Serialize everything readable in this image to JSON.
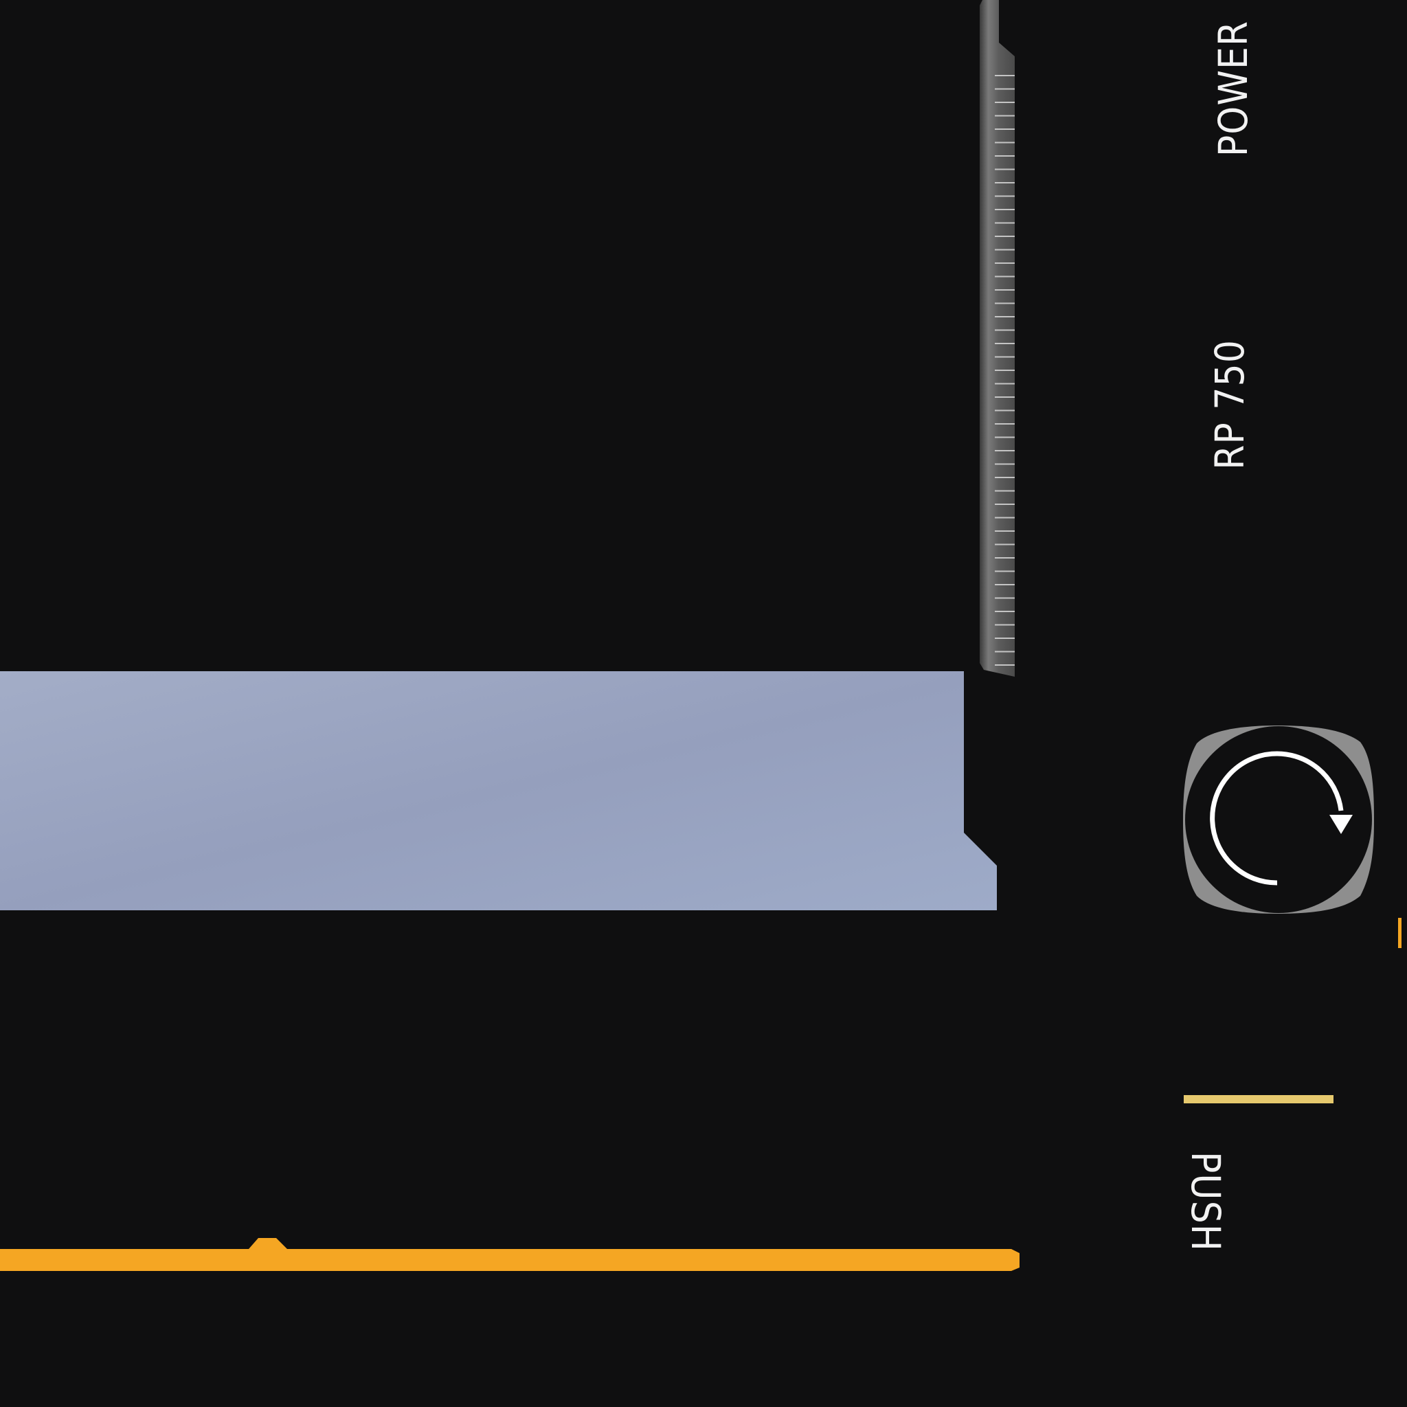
{
  "labels": {
    "power": "POWER",
    "model": "RP 750",
    "push": "PUSH"
  },
  "controls": {
    "rotate_icon": "rotate-clockwise-icon"
  },
  "colors": {
    "background": "#0f0f10",
    "blue_panel": "#9ba7c3",
    "orange_accent": "#f5a623",
    "yellow_bar": "#e6c96e",
    "button_bezel": "#8e8e8e",
    "metal": "#5a5a5a"
  }
}
